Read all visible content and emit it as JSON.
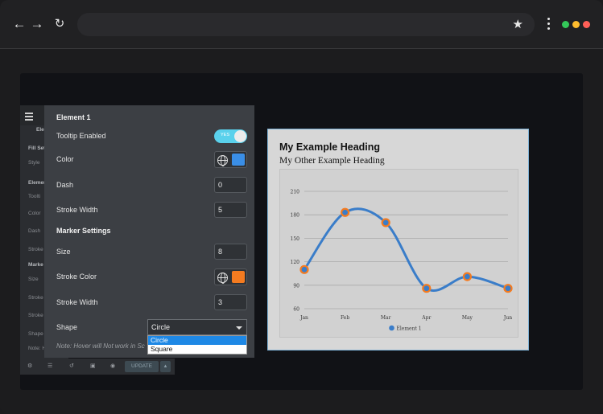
{
  "browser": {
    "back_icon": "arrow-left-icon",
    "forward_icon": "arrow-right-icon",
    "reload_icon": "reload-icon",
    "bookmark_icon": "star-icon",
    "menu_icon": "kebab-icon",
    "traffic_lights": [
      "#34c759",
      "#ffbd2e",
      "#ff5f57"
    ]
  },
  "sidebar": {
    "items": [
      {
        "label": "Ele",
        "bold": true
      },
      {
        "label": "Fill Set",
        "bold": true
      },
      {
        "label": "Style",
        "bold": false
      },
      {
        "label": "Element",
        "bold": true
      },
      {
        "label": "Toolti",
        "bold": false
      },
      {
        "label": "Color",
        "bold": false
      },
      {
        "label": "Dash",
        "bold": false
      },
      {
        "label": "Stroke",
        "bold": false
      },
      {
        "label": "Marke",
        "bold": true
      },
      {
        "label": "Size",
        "bold": false
      },
      {
        "label": "Stroke",
        "bold": false
      },
      {
        "label": "Stroke",
        "bold": false
      },
      {
        "label": "Shape",
        "bold": false
      },
      {
        "label": "Note: H",
        "bold": false
      }
    ]
  },
  "bottom_bar": {
    "update_label": "UPDATE",
    "icons": [
      "gear-icon",
      "layers-icon",
      "history-icon",
      "responsive-icon",
      "eye-icon"
    ]
  },
  "panel": {
    "title": "Element 1",
    "tooltip_label": "Tooltip Enabled",
    "tooltip_toggle_text": "YES",
    "color_label": "Color",
    "color_value": "#3a8ee6",
    "dash_label": "Dash",
    "dash_value": "0",
    "stroke_width_label": "Stroke Width",
    "stroke_width_value": "5",
    "marker_heading": "Marker Settings",
    "size_label": "Size",
    "size_value": "8",
    "stroke_color_label": "Stroke Color",
    "stroke_color_value": "#f47b20",
    "marker_stroke_width_label": "Stroke Width",
    "marker_stroke_width_value": "3",
    "shape_label": "Shape",
    "shape_value": "Circle",
    "shape_options": [
      "Circle",
      "Square"
    ],
    "note": "Note: Hover will Not work in Sc"
  },
  "card": {
    "heading": "My Example Heading",
    "subheading": "My Other Example Heading"
  },
  "chart_data": {
    "type": "line",
    "categories": [
      "Jan",
      "Feb",
      "Mar",
      "Apr",
      "May",
      "Jun"
    ],
    "series": [
      {
        "name": "Element 1",
        "values": [
          110,
          183,
          170,
          86,
          101,
          86
        ],
        "color": "#3a7dc9",
        "marker_stroke": "#f47b20"
      }
    ],
    "yticks": [
      60,
      90,
      120,
      150,
      180,
      210
    ],
    "ylim": [
      60,
      210
    ],
    "grid": true,
    "curve": "smooth",
    "legend_position": "bottom"
  }
}
